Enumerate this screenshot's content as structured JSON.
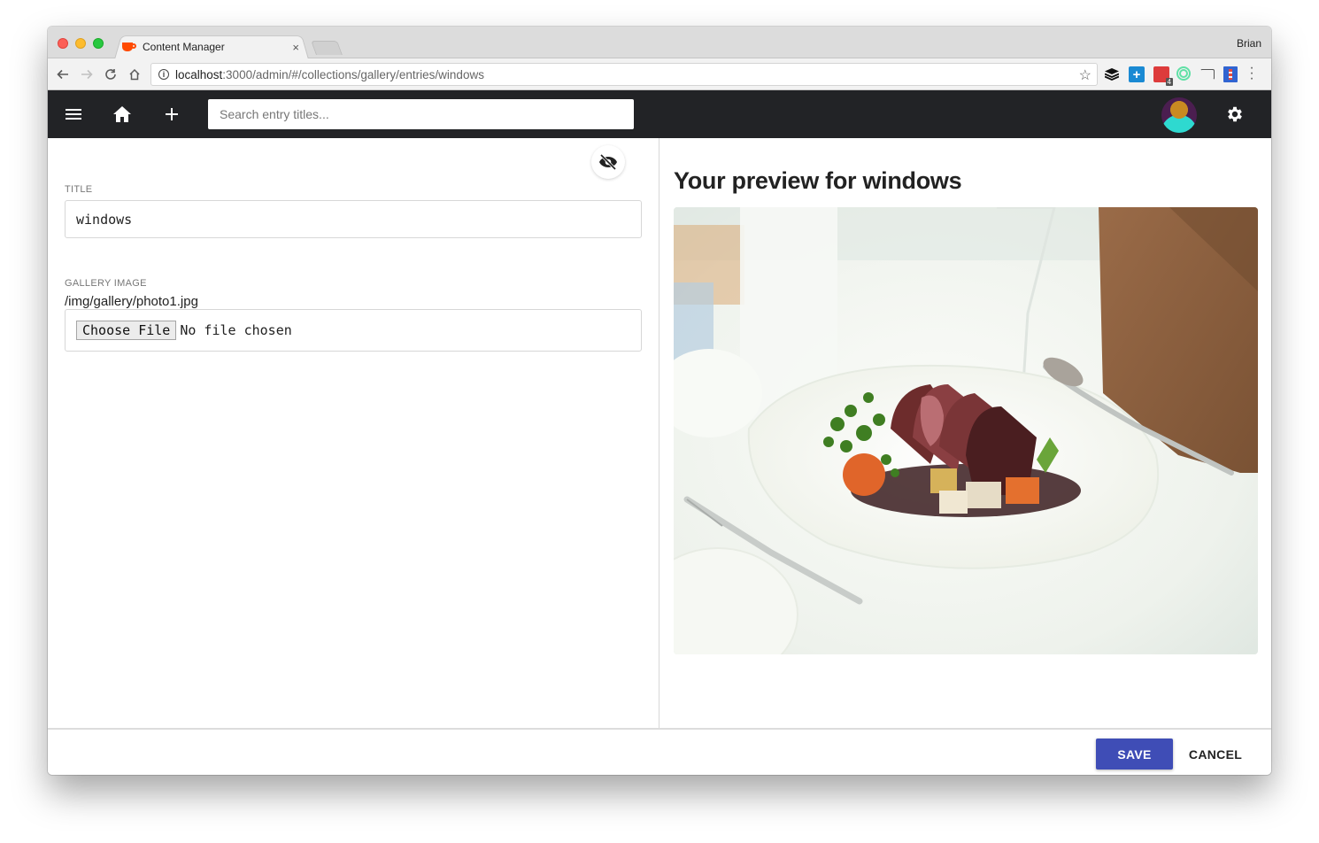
{
  "browser": {
    "tab_title": "Content Manager",
    "tab_close": "×",
    "profile_name": "Brian",
    "url_host": "localhost",
    "url_path": ":3000/admin/#/collections/gallery/entries/windows",
    "extensions": [
      "layers-icon",
      "plus-extension-icon",
      "calendar-extension-icon",
      "radar-extension-icon",
      "cast-icon",
      "lighthouse-extension-icon"
    ],
    "calendar_badge": "4"
  },
  "appbar": {
    "search_placeholder": "Search entry titles..."
  },
  "editor": {
    "title_label": "Title",
    "title_value": "windows",
    "image_label": "Gallery Image",
    "image_path": "/img/gallery/photo1.jpg",
    "choose_file_label": "Choose File",
    "no_file_text": "No file chosen"
  },
  "preview": {
    "heading": "Your preview for windows",
    "image_alt": "Plated steak with vegetables on a white table"
  },
  "footer": {
    "save_label": "SAVE",
    "cancel_label": "CANCEL"
  },
  "colors": {
    "appbar_bg": "#222326",
    "save_button": "#3f4db6"
  }
}
